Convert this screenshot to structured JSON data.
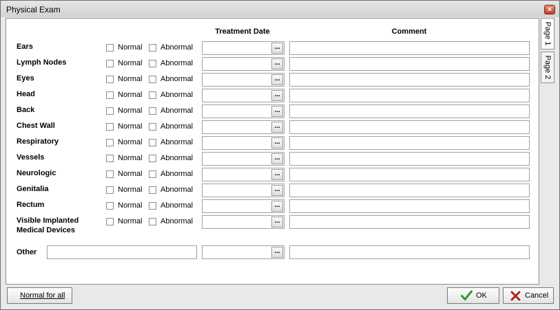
{
  "window": {
    "title": "Physical Exam",
    "close_glyph": "×"
  },
  "columns": {
    "treatment_date": "Treatment Date",
    "comment": "Comment"
  },
  "options": {
    "normal": "Normal",
    "abnormal": "Abnormal"
  },
  "rows": [
    {
      "label": "Ears"
    },
    {
      "label": "Lymph Nodes"
    },
    {
      "label": "Eyes"
    },
    {
      "label": "Head"
    },
    {
      "label": "Back"
    },
    {
      "label": "Chest Wall"
    },
    {
      "label": "Respiratory"
    },
    {
      "label": "Vessels"
    },
    {
      "label": "Neurologic"
    },
    {
      "label": "Genitalia"
    },
    {
      "label": "Rectum"
    },
    {
      "label": "Visible Implanted",
      "label2": "Medical Devices"
    }
  ],
  "other": {
    "label": "Other"
  },
  "picker": {
    "glyph": "..."
  },
  "tabs": {
    "page1": "Page 1",
    "page2": "Page 2"
  },
  "buttons": {
    "normal_for_all": "Normal for all",
    "ok": "OK",
    "cancel": "Cancel"
  },
  "colors": {
    "ok_check": "#2e9a2e",
    "cancel_x": "#b02418",
    "close_button": "#c1392b"
  }
}
